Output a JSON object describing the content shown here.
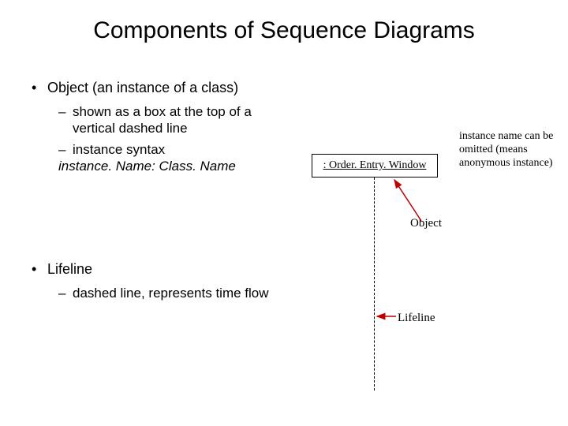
{
  "title": "Components of Sequence Diagrams",
  "bullets": {
    "object": {
      "heading": "Object (an instance of a class)",
      "sub1": "shown as a box at the top of a vertical dashed line",
      "sub2": "instance syntax",
      "syntax": "instance. Name: Class. Name"
    },
    "lifeline": {
      "heading": "Lifeline",
      "sub1": "dashed line, represents time flow"
    }
  },
  "diagram": {
    "box_label": ": Order. Entry. Window",
    "note": "instance name can be omitted (means anonymous instance)",
    "object_label": "Object",
    "lifeline_label": "Lifeline"
  }
}
